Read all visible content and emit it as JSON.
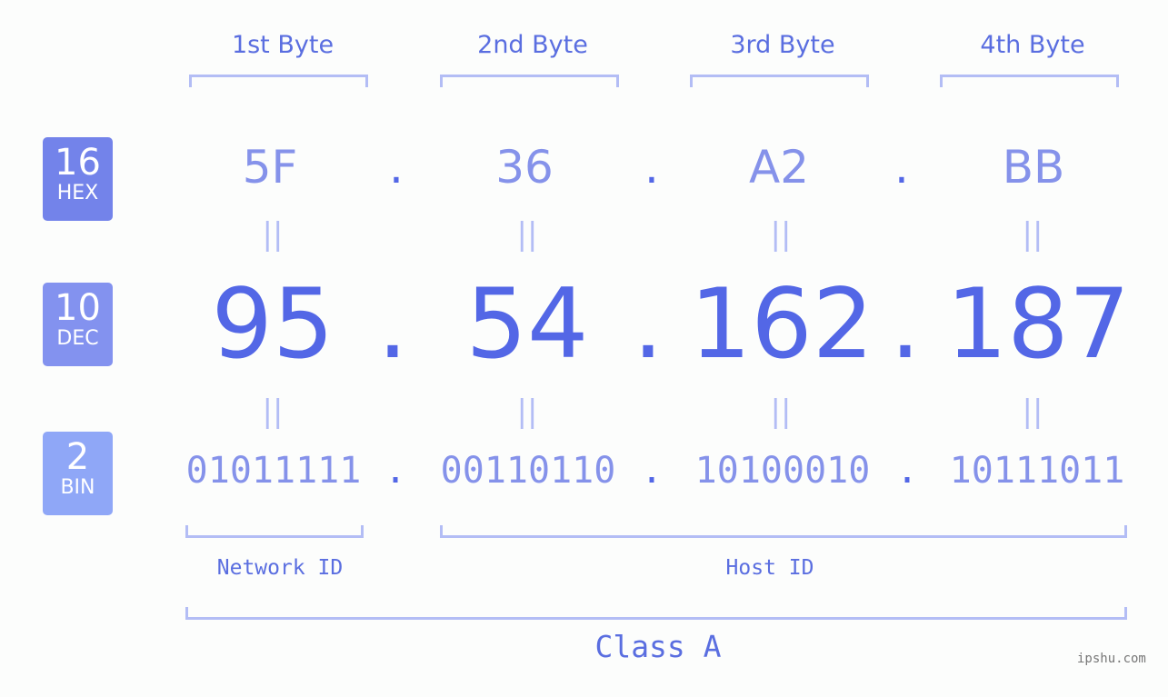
{
  "bytes": [
    {
      "label": "1st Byte",
      "hex": "5F",
      "dec": "95",
      "bin": "01011111"
    },
    {
      "label": "2nd Byte",
      "hex": "36",
      "dec": "54",
      "bin": "00110110"
    },
    {
      "label": "3rd Byte",
      "hex": "A2",
      "dec": "162",
      "bin": "10100010"
    },
    {
      "label": "4th Byte",
      "hex": "BB",
      "dec": "187",
      "bin": "10111011"
    }
  ],
  "separator": ".",
  "equals": "||",
  "badges": {
    "hex": {
      "num": "16",
      "label": "HEX",
      "color": "#7383ea"
    },
    "dec": {
      "num": "10",
      "label": "DEC",
      "color": "#8392ef"
    },
    "bin": {
      "num": "2",
      "label": "BIN",
      "color": "#8fa7f7"
    }
  },
  "network_id_label": "Network ID",
  "host_id_label": "Host ID",
  "class_label": "Class A",
  "watermark": "ipshu.com"
}
